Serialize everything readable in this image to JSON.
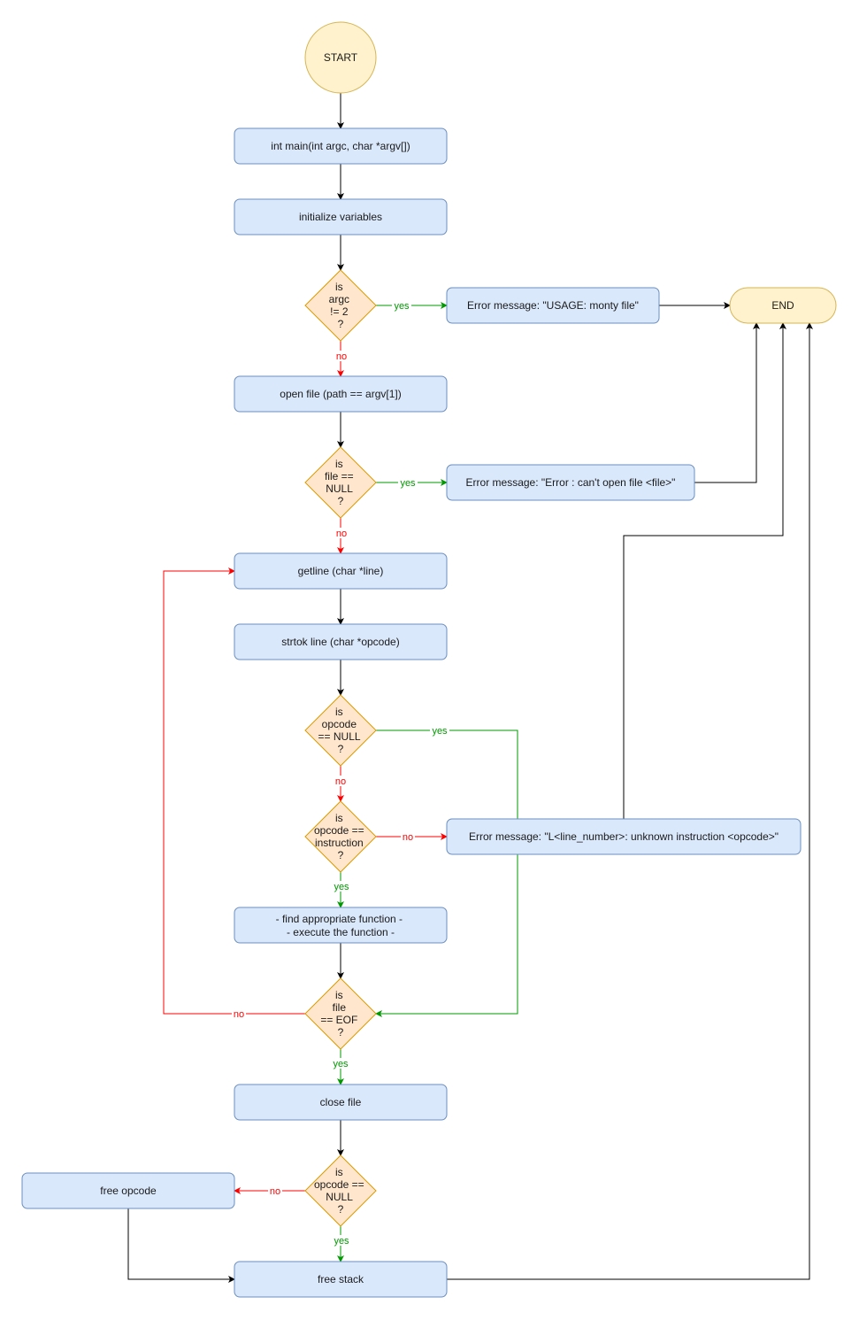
{
  "diagram": {
    "type": "flowchart",
    "nodes": {
      "start": "START",
      "end": "END",
      "main": "int main(int argc, char *argv[])",
      "init": "initialize variables",
      "dec_argc": [
        "is",
        "argc",
        "!= 2",
        "?"
      ],
      "err_usage": "Error message: \"USAGE: monty file\"",
      "open_file": "open file (path == argv[1])",
      "dec_file_null": [
        "is",
        "file ==",
        "NULL",
        "?"
      ],
      "err_open": "Error message: \"Error : can't open file <file>\"",
      "getline": "getline (char *line)",
      "strtok": "strtok line (char *opcode)",
      "dec_opcode_null": [
        "is",
        "opcode",
        "== NULL",
        "?"
      ],
      "dec_opcode_instr": [
        "is",
        "opcode ==",
        "instruction",
        "?"
      ],
      "err_unknown": "Error message: \"L<line_number>: unknown instruction <opcode>\"",
      "exec": [
        "- find appropriate function -",
        "- execute the function -"
      ],
      "dec_eof": [
        "is",
        "file",
        "== EOF",
        "?"
      ],
      "close_file": "close file",
      "dec_opcode_null2": [
        "is",
        "opcode ==",
        "NULL",
        "?"
      ],
      "free_opcode": "free opcode",
      "free_stack": "free stack"
    },
    "edge_labels": {
      "yes": "yes",
      "no": "no"
    },
    "colors": {
      "process_fill": "#dae8fc",
      "process_stroke": "#6c8ebf",
      "terminal_fill": "#fff2cc",
      "terminal_stroke": "#d6b656",
      "decision_fill": "#ffe6cc",
      "decision_stroke": "#d79b00",
      "yes_edge": "#009900",
      "no_edge": "#ff0000",
      "default_edge": "#000000"
    }
  }
}
